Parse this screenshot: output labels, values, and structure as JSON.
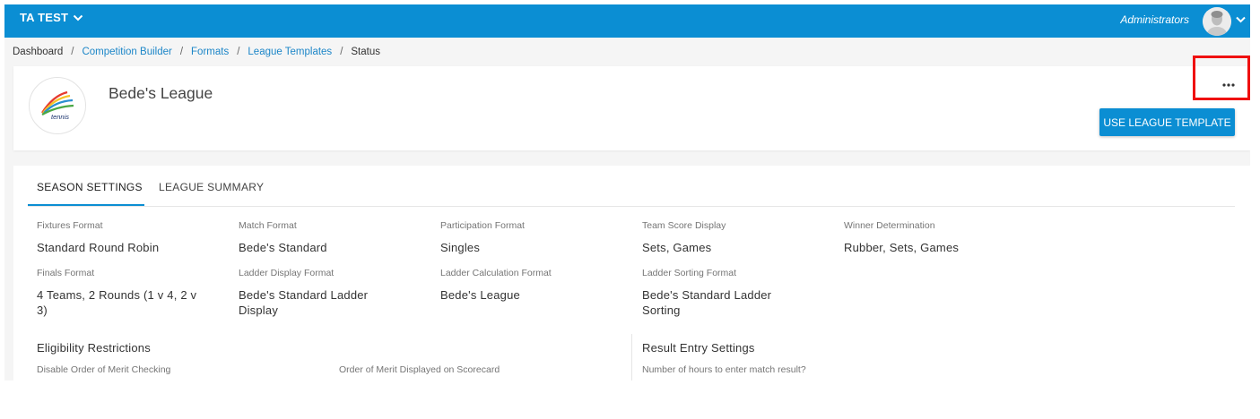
{
  "topbar": {
    "org_name": "TA TEST",
    "role": "Administrators",
    "icons": {
      "org_chevron": "chevron-down-icon",
      "user_chevron": "chevron-down-icon",
      "avatar": "user-avatar"
    }
  },
  "breadcrumb": {
    "items": [
      "Dashboard",
      "Competition Builder",
      "Formats",
      "League Templates",
      "Status"
    ],
    "separator": "/"
  },
  "header": {
    "league_name": "Bede's League",
    "logo_text": "tennis",
    "more_icon": "more-horizontal-icon",
    "use_template_label": "USE LEAGUE TEMPLATE"
  },
  "tabs": [
    {
      "label": "SEASON SETTINGS",
      "active": true
    },
    {
      "label": "LEAGUE SUMMARY",
      "active": false
    }
  ],
  "season_settings": {
    "fields": [
      {
        "label": "Fixtures Format",
        "value": "Standard Round Robin"
      },
      {
        "label": "Match Format",
        "value": "Bede's Standard"
      },
      {
        "label": "Participation Format",
        "value": "Singles"
      },
      {
        "label": "Team Score Display",
        "value": "Sets, Games"
      },
      {
        "label": "Winner Determination",
        "value": "Rubber, Sets, Games"
      },
      {
        "label": "Finals Format",
        "value": "4 Teams, 2 Rounds (1 v 4, 2 v 3)"
      },
      {
        "label": "Ladder Display Format",
        "value": "Bede's Standard Ladder Display"
      },
      {
        "label": "Ladder Calculation Format",
        "value": "Bede's League"
      },
      {
        "label": "Ladder Sorting Format",
        "value": "Bede's Standard Ladder Sorting"
      }
    ],
    "eligibility": {
      "title": "Eligibility Restrictions",
      "items": [
        "Disable Order of Merit Checking",
        "Order of Merit Displayed on Scorecard"
      ]
    },
    "result_entry": {
      "title": "Result Entry Settings",
      "items": [
        "Number of hours to enter match result?"
      ]
    }
  },
  "colors": {
    "primary": "#0b8ed3",
    "link": "#1c86c8",
    "highlight": "#ef1010",
    "background": "#f5f5f5"
  }
}
